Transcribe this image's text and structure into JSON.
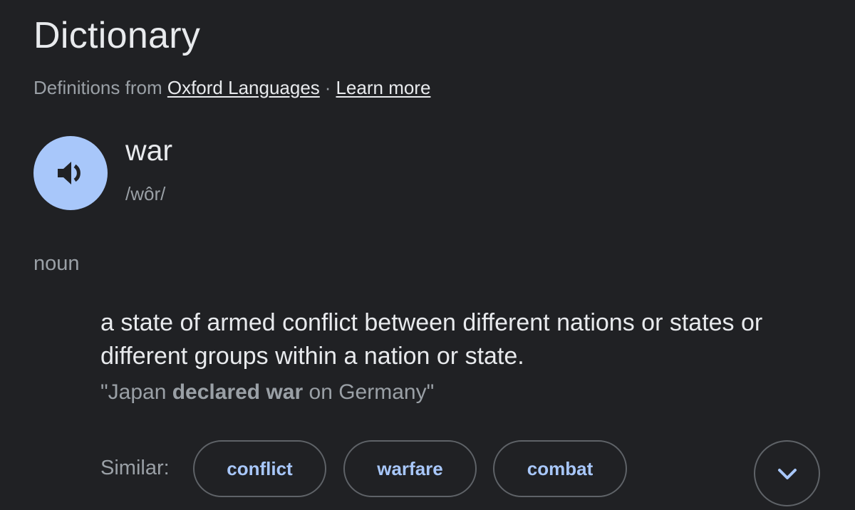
{
  "header": {
    "title": "Dictionary",
    "source_prefix": "Definitions from",
    "source_link": "Oxford Languages",
    "separator": "·",
    "learn_more": "Learn more"
  },
  "entry": {
    "word": "war",
    "phonetic": "/wôr/",
    "part_of_speech": "noun",
    "speaker_icon": "volume-up-icon",
    "definition": "a state of armed conflict between different nations or states or different groups within a nation or state.",
    "example": {
      "open_quote": "\"Japan ",
      "emphasis": "declared war",
      "rest": " on Germany\""
    }
  },
  "similar": {
    "label": "Similar:",
    "words": [
      "conflict",
      "warfare",
      "combat"
    ],
    "expand_icon": "chevron-down-icon"
  },
  "colors": {
    "background": "#202124",
    "text_primary": "#e8eaed",
    "text_secondary": "#9aa0a6",
    "accent": "#a8c7fa",
    "chip_border": "#5f6368"
  }
}
